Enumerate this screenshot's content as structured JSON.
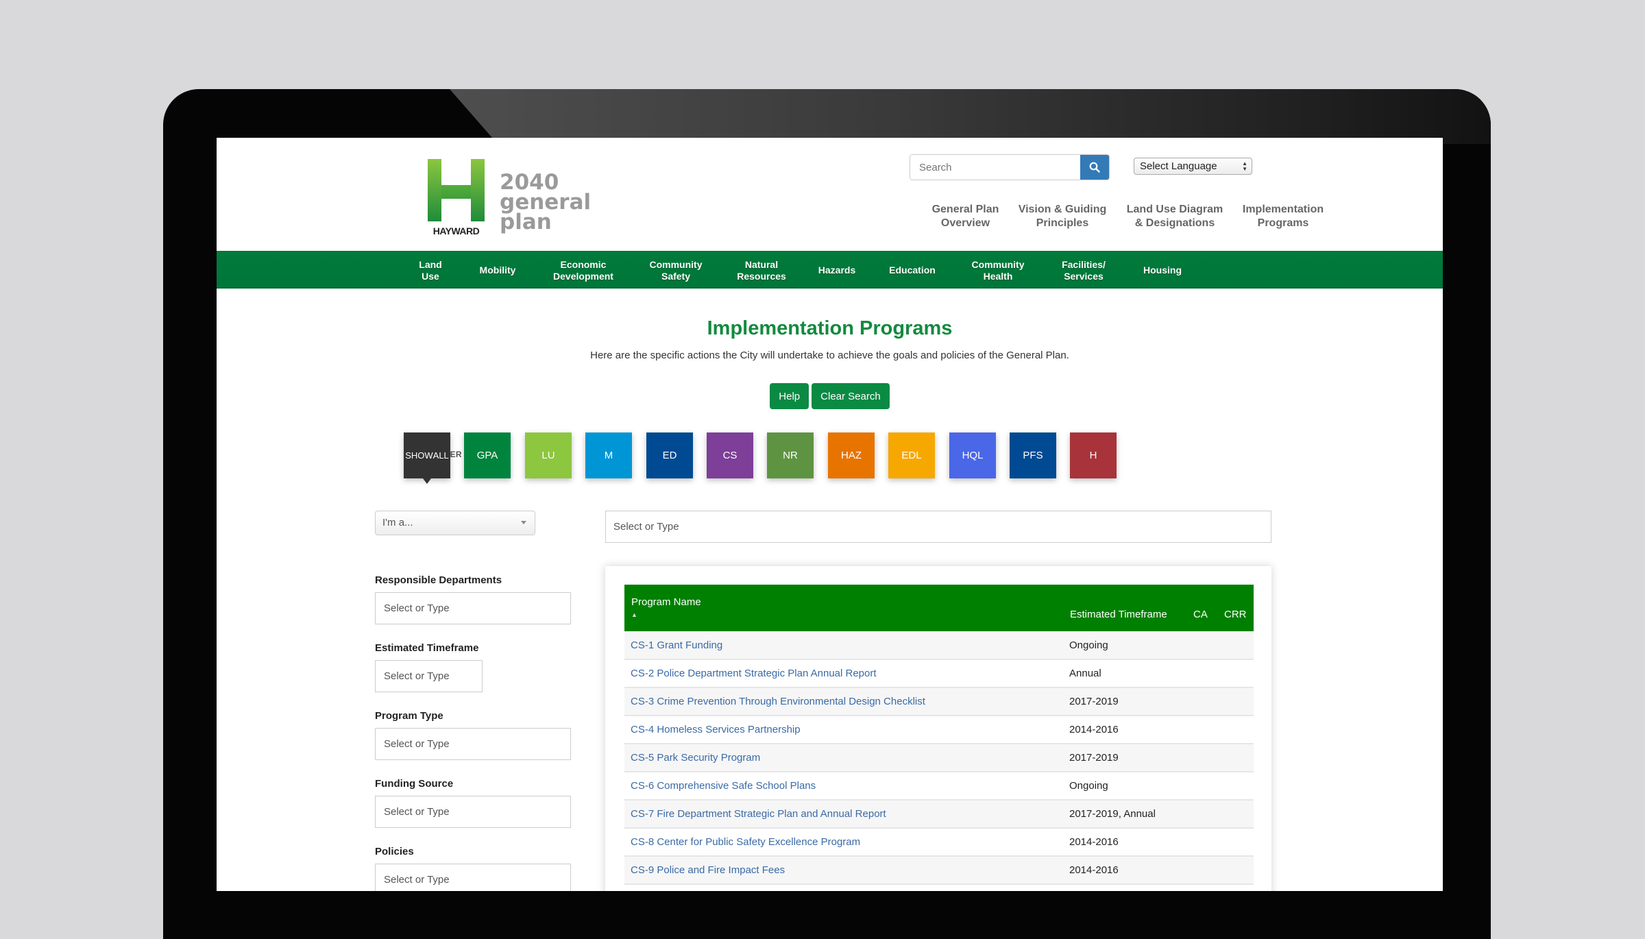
{
  "header": {
    "logo": {
      "wordmark": "HAYWARD",
      "line1": "2040",
      "line2": "general plan"
    },
    "search": {
      "placeholder": "Search"
    },
    "language_select": {
      "value": "Select Language"
    },
    "top_nav": [
      {
        "line1": "General Plan",
        "line2": "Overview"
      },
      {
        "line1": "Vision & Guiding",
        "line2": "Principles"
      },
      {
        "line1": "Land Use Diagram",
        "line2": "& Designations"
      },
      {
        "line1": "Implementation",
        "line2": "Programs"
      }
    ]
  },
  "element_nav": [
    {
      "line1": "Land",
      "line2": "Use"
    },
    {
      "line1": "Mobility",
      "line2": ""
    },
    {
      "line1": "Economic",
      "line2": "Development"
    },
    {
      "line1": "Community",
      "line2": "Safety"
    },
    {
      "line1": "Natural",
      "line2": "Resources"
    },
    {
      "line1": "Hazards",
      "line2": ""
    },
    {
      "line1": "Education",
      "line2": ""
    },
    {
      "line1": "Community",
      "line2": "Health"
    },
    {
      "line1": "Facilities/",
      "line2": "Services"
    },
    {
      "line1": "Housing",
      "line2": ""
    }
  ],
  "page": {
    "title": "Implementation Programs",
    "tagline": "Here are the specific actions the City will undertake to achieve the goals and policies of the General Plan.",
    "help_label": "Help",
    "clear_label": "Clear Search"
  },
  "filters": {
    "label": "FILTER BY:",
    "chips": [
      {
        "line1": "SHOW",
        "line2": "ALL",
        "color": "#333333",
        "active": true
      },
      {
        "line1": "GPA",
        "line2": "",
        "color": "#00843d"
      },
      {
        "line1": "LU",
        "line2": "",
        "color": "#8dc63f"
      },
      {
        "line1": "M",
        "line2": "",
        "color": "#0096d6"
      },
      {
        "line1": "ED",
        "line2": "",
        "color": "#004a93"
      },
      {
        "line1": "CS",
        "line2": "",
        "color": "#7d3f98"
      },
      {
        "line1": "NR",
        "line2": "",
        "color": "#5e9441"
      },
      {
        "line1": "HAZ",
        "line2": "",
        "color": "#e87400"
      },
      {
        "line1": "EDL",
        "line2": "",
        "color": "#f7a800"
      },
      {
        "line1": "HQL",
        "line2": "",
        "color": "#4a67e8"
      },
      {
        "line1": "PFS",
        "line2": "",
        "color": "#004a93"
      },
      {
        "line1": "H",
        "line2": "",
        "color": "#a8333b"
      }
    ],
    "role_select": "I'm a...",
    "main_search_placeholder": "Select or Type",
    "fields": [
      {
        "label": "Responsible Departments",
        "placeholder": "Select or Type"
      },
      {
        "label": "Estimated Timeframe",
        "placeholder": "Select or Type"
      },
      {
        "label": "Program Type",
        "placeholder": "Select or Type"
      },
      {
        "label": "Funding Source",
        "placeholder": "Select or Type"
      },
      {
        "label": "Policies",
        "placeholder": "Select or Type"
      }
    ]
  },
  "table": {
    "columns": [
      "Program Name",
      "Estimated Timeframe",
      "CA",
      "CRR"
    ],
    "sort_indicator": "▲",
    "rows": [
      {
        "name": "CS-1 Grant Funding",
        "timeframe": "Ongoing",
        "ca": "",
        "crr": ""
      },
      {
        "name": "CS-2 Police Department Strategic Plan Annual Report",
        "timeframe": "Annual",
        "ca": "",
        "crr": ""
      },
      {
        "name": "CS-3 Crime Prevention Through Environmental Design Checklist",
        "timeframe": "2017-2019",
        "ca": "",
        "crr": ""
      },
      {
        "name": "CS-4 Homeless Services Partnership",
        "timeframe": "2014-2016",
        "ca": "",
        "crr": ""
      },
      {
        "name": "CS-5 Park Security Program",
        "timeframe": "2017-2019",
        "ca": "",
        "crr": ""
      },
      {
        "name": "CS-6 Comprehensive Safe School Plans",
        "timeframe": "Ongoing",
        "ca": "",
        "crr": ""
      },
      {
        "name": "CS-7 Fire Department Strategic Plan and Annual Report",
        "timeframe": "2017-2019, Annual",
        "ca": "",
        "crr": ""
      },
      {
        "name": "CS-8 Center for Public Safety Excellence Program",
        "timeframe": "2014-2016",
        "ca": "",
        "crr": ""
      },
      {
        "name": "CS-9 Police and Fire Impact Fees",
        "timeframe": "2014-2016",
        "ca": "",
        "crr": ""
      }
    ]
  }
}
